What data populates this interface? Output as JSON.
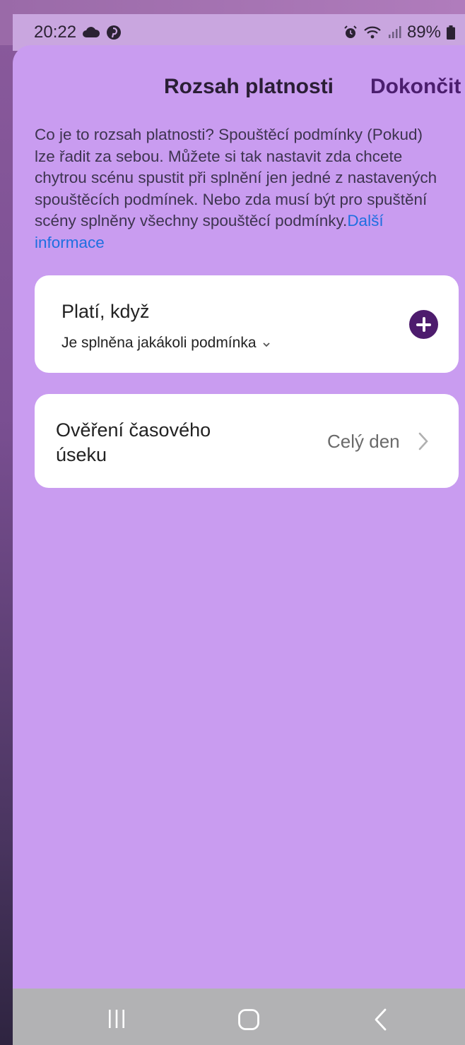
{
  "status_bar": {
    "time": "20:22",
    "battery": "89%",
    "icons": [
      "cloud-icon",
      "pinterest-icon",
      "alarm-icon",
      "wifi-icon",
      "signal-icon",
      "battery-icon"
    ]
  },
  "header": {
    "title": "Rozsah platnosti",
    "done_label": "Dokončit"
  },
  "description": {
    "text": "Co je to rozsah platnosti? Spouštěcí podmínky (Pokud) lze řadit za sebou. Můžete si tak nastavit zda chcete chytrou scénu spustit při splnění jen jedné z nastavených spouštěcích podmínek. Nebo zda musí být pro spuštění scény splněny všechny spouštěcí podmínky.",
    "link": "Další informace"
  },
  "condition_card": {
    "title": "Platí, když",
    "selected_option": "Je splněna jakákoli podmínka"
  },
  "time_card": {
    "title": "Ověření časového úseku",
    "value": "Celý den"
  },
  "colors": {
    "sheet_background": "#c99cf0",
    "accent": "#4d1c6d",
    "link": "#1e6fe0",
    "card": "#ffffff"
  }
}
